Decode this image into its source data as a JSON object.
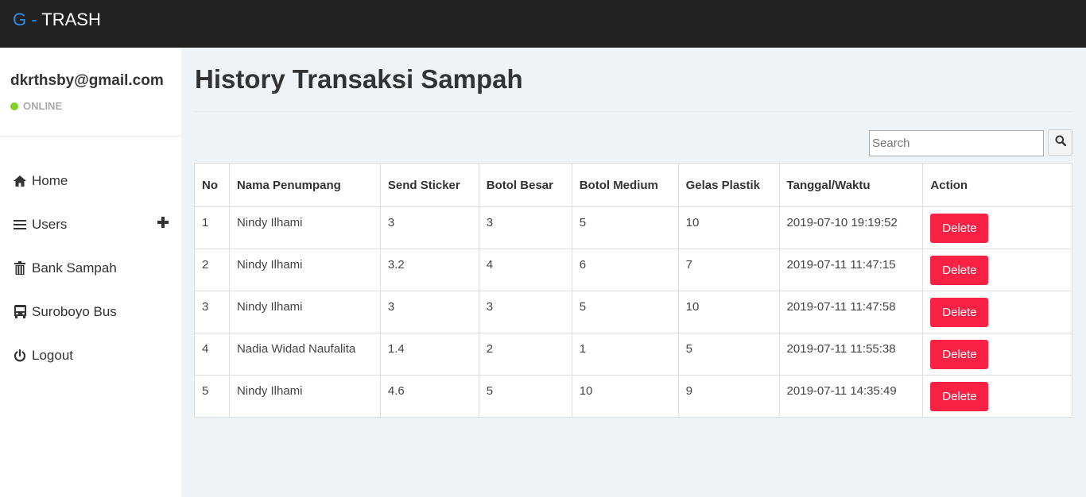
{
  "brand": {
    "prefix": "G -",
    "name": "TRASH"
  },
  "colors": {
    "topbar": "#222222",
    "accent": "#2d8ee6",
    "online": "#7ed321",
    "delete": "#f92244",
    "content_bg": "#eff3f6"
  },
  "user": {
    "email": "dkrthsby@gmail.com",
    "status": "ONLINE"
  },
  "nav": [
    {
      "label": "Home",
      "icon": "home-icon"
    },
    {
      "label": "Users",
      "icon": "bars-icon",
      "extra_icon": "plus-icon"
    },
    {
      "label": "Bank Sampah",
      "icon": "trash-icon"
    },
    {
      "label": "Suroboyo Bus",
      "icon": "bus-icon"
    },
    {
      "label": "Logout",
      "icon": "power-icon"
    }
  ],
  "page": {
    "title": "History Transaksi Sampah"
  },
  "search": {
    "placeholder": "Search",
    "button_icon": "search-icon"
  },
  "table": {
    "headers": [
      "No",
      "Nama Penumpang",
      "Send Sticker",
      "Botol Besar",
      "Botol Medium",
      "Gelas Plastik",
      "Tanggal/Waktu",
      "Action"
    ],
    "rows": [
      {
        "no": "1",
        "nama": "Nindy Ilhami",
        "sticker": "3",
        "besar": "3",
        "medium": "5",
        "gelas": "10",
        "waktu": "2019-07-10 19:19:52",
        "action": "Delete"
      },
      {
        "no": "2",
        "nama": "Nindy Ilhami",
        "sticker": "3.2",
        "besar": "4",
        "medium": "6",
        "gelas": "7",
        "waktu": "2019-07-11 11:47:15",
        "action": "Delete"
      },
      {
        "no": "3",
        "nama": "Nindy Ilhami",
        "sticker": "3",
        "besar": "3",
        "medium": "5",
        "gelas": "10",
        "waktu": "2019-07-11 11:47:58",
        "action": "Delete"
      },
      {
        "no": "4",
        "nama": "Nadia Widad Naufalita",
        "sticker": "1.4",
        "besar": "2",
        "medium": "1",
        "gelas": "5",
        "waktu": "2019-07-11 11:55:38",
        "action": "Delete"
      },
      {
        "no": "5",
        "nama": "Nindy Ilhami",
        "sticker": "4.6",
        "besar": "5",
        "medium": "10",
        "gelas": "9",
        "waktu": "2019-07-11 14:35:49",
        "action": "Delete"
      }
    ]
  }
}
